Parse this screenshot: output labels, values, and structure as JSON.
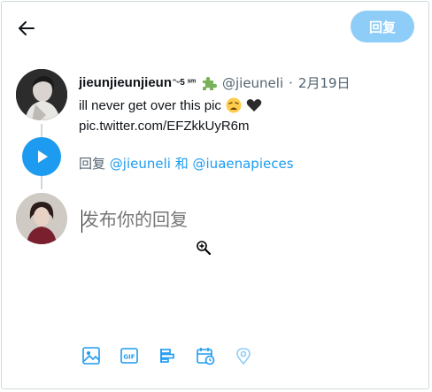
{
  "header": {
    "reply_button_label": "回复"
  },
  "original_tweet": {
    "display_name": "jieunjieunjieun",
    "name_suffix": "ᵔᵕ5 ˢᵐ",
    "handle": "@jieuneli",
    "separator": "·",
    "date": "2月19日",
    "text": "ill never get over this pic",
    "link": "pic.twitter.com/EFZkkUyR6m",
    "emojis": [
      "weary-face-emoji",
      "black-heart-emoji"
    ]
  },
  "reply_context": {
    "prefix": "回复",
    "mention_1": "@jieuneli",
    "joiner": "和",
    "mention_2": "@iuaenapieces"
  },
  "composer": {
    "placeholder": "发布你的回复"
  },
  "toolbar": {
    "icons": [
      "image-icon",
      "gif-icon",
      "poll-icon",
      "schedule-icon",
      "location-icon"
    ]
  },
  "colors": {
    "accent": "#1d9bf0",
    "reply_button_disabled": "#8ecdf8",
    "muted_text": "#536471"
  }
}
